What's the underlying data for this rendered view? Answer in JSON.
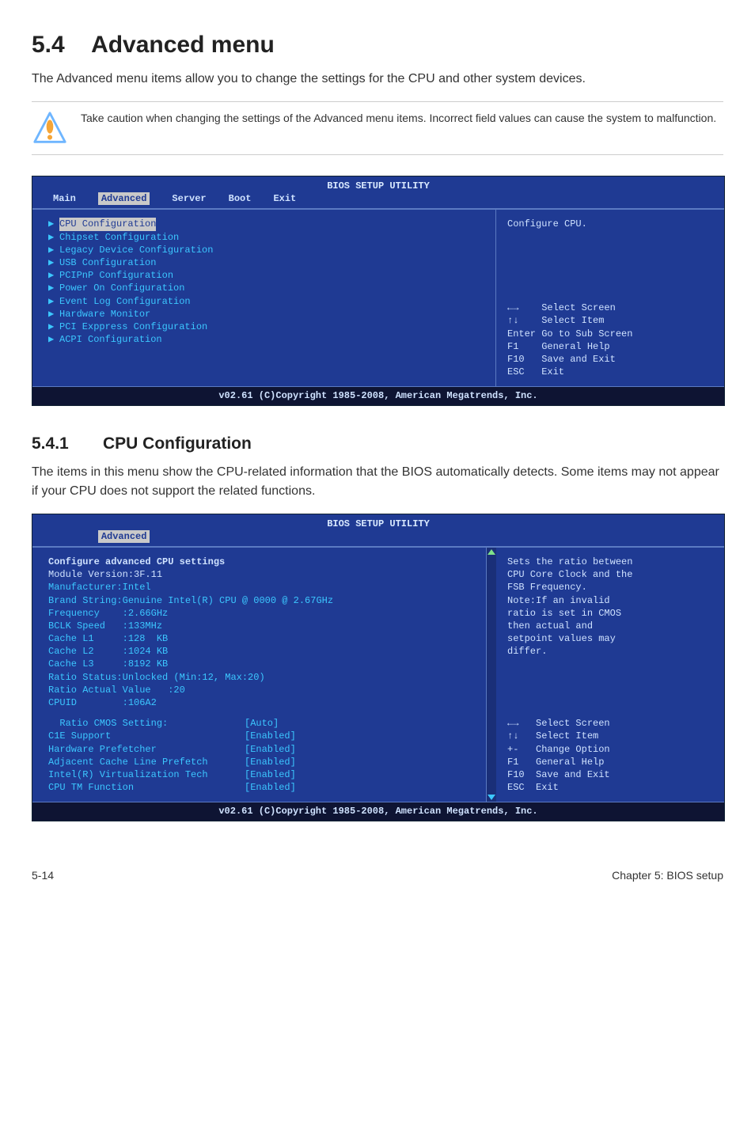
{
  "section": {
    "number": "5.4",
    "title": "Advanced menu",
    "lead": "The Advanced menu items allow you to change the settings for the CPU and other system devices.",
    "callout": "Take caution when changing the settings of the Advanced menu items. Incorrect field values can cause the system to malfunction."
  },
  "bios1": {
    "title": "BIOS SETUP UTILITY",
    "menu": {
      "main": "Main",
      "advanced": "Advanced",
      "server": "Server",
      "boot": "Boot",
      "exit": "Exit"
    },
    "items": [
      "CPU Configuration",
      "Chipset Configuration",
      "Legacy Device Configuration",
      "USB Configuration",
      "PCIPnP Configuration",
      "Power On Configuration",
      "Event Log Configuration",
      "Hardware Monitor",
      "PCI Exppress Configuration",
      "ACPI Configuration"
    ],
    "help": "Configure CPU.",
    "keys": "←→    Select Screen\n↑↓    Select Item\nEnter Go to Sub Screen\nF1    General Help\nF10   Save and Exit\nESC   Exit",
    "footer": "v02.61 (C)Copyright 1985-2008, American Megatrends, Inc."
  },
  "sub541": {
    "number": "5.4.1",
    "title": "CPU Configuration",
    "lead": "The items in this menu show the CPU-related information that the BIOS automatically detects. Some items may not appear if your CPU does not support the related functions."
  },
  "bios2": {
    "title": "BIOS SETUP UTILITY",
    "menu": {
      "advanced": "Advanced"
    },
    "header1": "Configure advanced CPU settings",
    "header2": "Module Version:3F.11",
    "info": [
      "Manufacturer:Intel",
      "Brand String:Genuine Intel(R) CPU @ 0000 @ 2.67GHz",
      "Frequency    :2.66GHz",
      "BCLK Speed   :133MHz",
      "Cache L1     :128  KB",
      "Cache L2     :1024 KB",
      "Cache L3     :8192 KB",
      "Ratio Status:Unlocked (Min:12, Max:20)",
      "Ratio Actual Value   :20",
      "CPUID        :106A2"
    ],
    "settings": [
      {
        "label": "  Ratio CMOS Setting:",
        "value": "[Auto]"
      },
      {
        "label": "C1E Support",
        "value": "[Enabled]"
      },
      {
        "label": "Hardware Prefetcher",
        "value": "[Enabled]"
      },
      {
        "label": "Adjacent Cache Line Prefetch",
        "value": "[Enabled]"
      },
      {
        "label": "Intel(R) Virtualization Tech",
        "value": "[Enabled]"
      },
      {
        "label": "CPU TM Function",
        "value": "[Enabled]"
      }
    ],
    "help": "Sets the ratio between\nCPU Core Clock and the\nFSB Frequency.\nNote:If an invalid\nratio is set in CMOS\nthen actual and\nsetpoint values may\ndiffer.",
    "keys": "←→   Select Screen\n↑↓   Select Item\n+-   Change Option\nF1   General Help\nF10  Save and Exit\nESC  Exit",
    "footer": "v02.61 (C)Copyright 1985-2008, American Megatrends, Inc."
  },
  "footer": {
    "left": "5-14",
    "right": "Chapter 5: BIOS setup"
  }
}
